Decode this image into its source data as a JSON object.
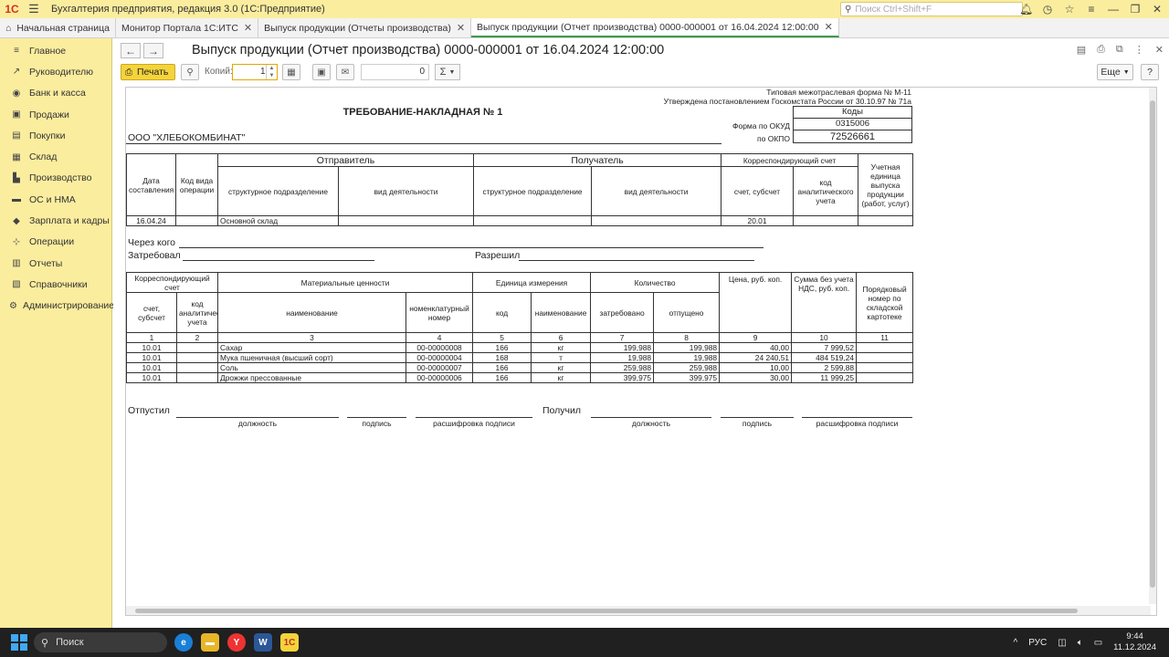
{
  "app": {
    "title": "Бухгалтерия предприятия, редакция 3.0  (1С:Предприятие)",
    "logo": "1С",
    "search_placeholder": "Поиск Ctrl+Shift+F"
  },
  "tabs": [
    {
      "label": "Начальная страница"
    },
    {
      "label": "Монитор Портала 1С:ИТС"
    },
    {
      "label": "Выпуск продукции (Отчеты производства)"
    },
    {
      "label": "Выпуск продукции (Отчет производства) 0000-000001 от 16.04.2024 12:00:00"
    }
  ],
  "sidebar": [
    {
      "label": "Главное",
      "icon": "≡"
    },
    {
      "label": "Руководителю",
      "icon": "↗"
    },
    {
      "label": "Банк и касса",
      "icon": "◉"
    },
    {
      "label": "Продажи",
      "icon": "▣"
    },
    {
      "label": "Покупки",
      "icon": "▤"
    },
    {
      "label": "Склад",
      "icon": "▦"
    },
    {
      "label": "Производство",
      "icon": "▙"
    },
    {
      "label": "ОС и НМА",
      "icon": "▬"
    },
    {
      "label": "Зарплата и кадры",
      "icon": "◆"
    },
    {
      "label": "Операции",
      "icon": "⊹"
    },
    {
      "label": "Отчеты",
      "icon": "▥"
    },
    {
      "label": "Справочники",
      "icon": "▧"
    },
    {
      "label": "Администрирование",
      "icon": "⚙"
    }
  ],
  "doc": {
    "title": "Выпуск продукции (Отчет производства) 0000-000001 от 16.04.2024 12:00:00",
    "print_label": "Печать",
    "copies_label": "Копий:",
    "copies_value": "1",
    "sum_value": "0",
    "sigma": "Σ",
    "more_label": "Еще",
    "help_label": "?"
  },
  "form": {
    "header1": "Типовая межотраслевая форма № М-11",
    "header2": "Утверждена постановлением Госкомстата России от 30.10.97 № 71а",
    "title": "ТРЕБОВАНИЕ-НАКЛАДНАЯ № 1",
    "org": "ООО \"ХЛЕБОКОМБИНАТ\"",
    "codes_label": "Коды",
    "okud_label": "Форма по ОКУД",
    "okud": "0315006",
    "okpo_label": "по ОКПО",
    "okpo": "72526661",
    "t1": {
      "sender": "Отправитель",
      "receiver": "Получатель",
      "corr": "Корреспондирующий счет",
      "unit": "Учетная единица выпуска продукции (работ, услуг)",
      "date": "Дата составления",
      "op": "Код вида операции",
      "struct": "структурное подразделение",
      "activity": "вид деятельности",
      "account": "счет, субсчет",
      "analytic": "код аналитического учета",
      "row_date": "16.04.24",
      "row_sender": "Основной склад",
      "row_account": "20.01"
    },
    "through": "Через кого",
    "requested": "Затребовал",
    "permitted": "Разрешил",
    "t2": {
      "corr": "Корреспондирующий счет",
      "materials": "Материальные ценности",
      "unit": "Единица измерения",
      "qty": "Количество",
      "price": "Цена, руб. коп.",
      "sum": "Сумма без учета НДС, руб. коп.",
      "card": "Порядковый номер по складской картотеке",
      "account": "счет, субсчет",
      "analytic": "код аналитического учета",
      "name": "наименование",
      "nom": "номенклатурный номер",
      "code": "код",
      "uname": "наименование",
      "requested": "затребовано",
      "released": "отпущено",
      "nums": [
        "1",
        "2",
        "3",
        "4",
        "5",
        "6",
        "7",
        "8",
        "9",
        "10",
        "11"
      ],
      "rows": [
        {
          "account": "10.01",
          "name": "Сахар",
          "nom": "00-00000008",
          "code": "166",
          "unit": "кг",
          "req": "199,988",
          "rel": "199,988",
          "price": "40,00",
          "sum": "7 999,52"
        },
        {
          "account": "10.01",
          "name": "Мука пшеничная (высший сорт)",
          "nom": "00-00000004",
          "code": "168",
          "unit": "т",
          "req": "19,988",
          "rel": "19,988",
          "price": "24 240,51",
          "sum": "484 519,24"
        },
        {
          "account": "10.01",
          "name": "Соль",
          "nom": "00-00000007",
          "code": "166",
          "unit": "кг",
          "req": "259,988",
          "rel": "259,988",
          "price": "10,00",
          "sum": "2 599,88"
        },
        {
          "account": "10.01",
          "name": "Дрожжи прессованные",
          "nom": "00-00000006",
          "code": "166",
          "unit": "кг",
          "req": "399,975",
          "rel": "399,975",
          "price": "30,00",
          "sum": "11 999,25"
        }
      ]
    },
    "released_by": "Отпустил",
    "received_by": "Получил",
    "position": "должность",
    "signature": "подпись",
    "decoding": "расшифровка подписи"
  },
  "taskbar": {
    "search": "Поиск",
    "lang": "РУС",
    "time": "9:44",
    "date": "11.12.2024"
  }
}
